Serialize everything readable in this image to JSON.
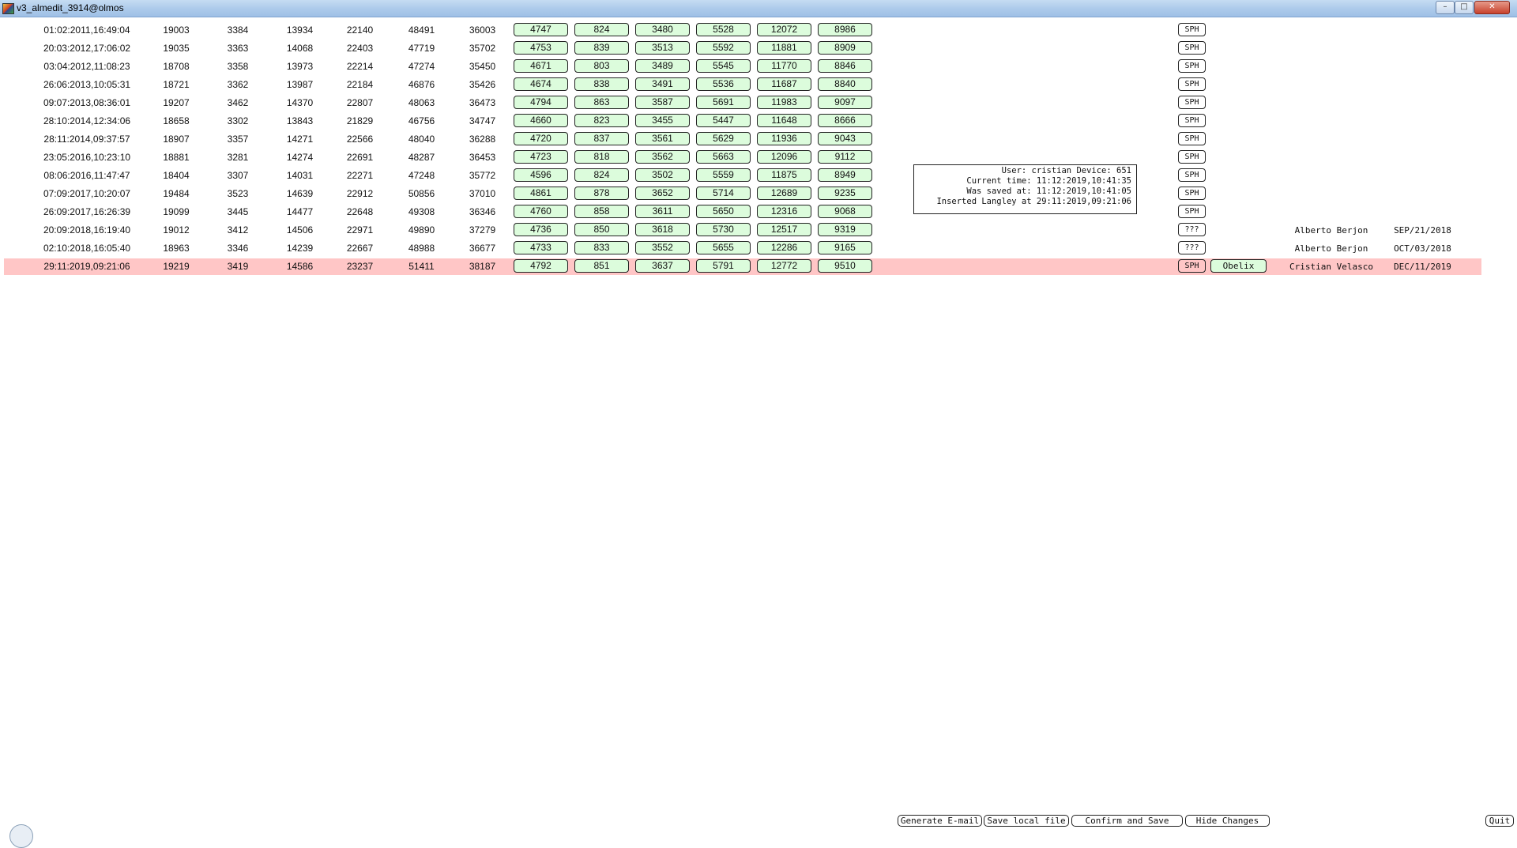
{
  "window": {
    "title": "v3_almedit_3914@olmos",
    "minimize_label": "–",
    "maximize_label": "□",
    "close_label": "✕"
  },
  "rows": [
    {
      "timestamp": "01:02:2011,16:49:04",
      "vals": [
        "19003",
        "3384",
        "13934",
        "22140",
        "48491",
        "36003"
      ],
      "editable": [
        "4747",
        "824",
        "3480",
        "5528",
        "12072",
        "8986"
      ],
      "tag": "SPH"
    },
    {
      "timestamp": "20:03:2012,17:06:02",
      "vals": [
        "19035",
        "3363",
        "14068",
        "22403",
        "47719",
        "35702"
      ],
      "editable": [
        "4753",
        "839",
        "3513",
        "5592",
        "11881",
        "8909"
      ],
      "tag": "SPH"
    },
    {
      "timestamp": "03:04:2012,11:08:23",
      "vals": [
        "18708",
        "3358",
        "13973",
        "22214",
        "47274",
        "35450"
      ],
      "editable": [
        "4671",
        "803",
        "3489",
        "5545",
        "11770",
        "8846"
      ],
      "tag": "SPH"
    },
    {
      "timestamp": "26:06:2013,10:05:31",
      "vals": [
        "18721",
        "3362",
        "13987",
        "22184",
        "46876",
        "35426"
      ],
      "editable": [
        "4674",
        "838",
        "3491",
        "5536",
        "11687",
        "8840"
      ],
      "tag": "SPH"
    },
    {
      "timestamp": "09:07:2013,08:36:01",
      "vals": [
        "19207",
        "3462",
        "14370",
        "22807",
        "48063",
        "36473"
      ],
      "editable": [
        "4794",
        "863",
        "3587",
        "5691",
        "11983",
        "9097"
      ],
      "tag": "SPH"
    },
    {
      "timestamp": "28:10:2014,12:34:06",
      "vals": [
        "18658",
        "3302",
        "13843",
        "21829",
        "46756",
        "34747"
      ],
      "editable": [
        "4660",
        "823",
        "3455",
        "5447",
        "11648",
        "8666"
      ],
      "tag": "SPH"
    },
    {
      "timestamp": "28:11:2014,09:37:57",
      "vals": [
        "18907",
        "3357",
        "14271",
        "22566",
        "48040",
        "36288"
      ],
      "editable": [
        "4720",
        "837",
        "3561",
        "5629",
        "11936",
        "9043"
      ],
      "tag": "SPH"
    },
    {
      "timestamp": "23:05:2016,10:23:10",
      "vals": [
        "18881",
        "3281",
        "14274",
        "22691",
        "48287",
        "36453"
      ],
      "editable": [
        "4723",
        "818",
        "3562",
        "5663",
        "12096",
        "9112"
      ],
      "tag": "SPH"
    },
    {
      "timestamp": "08:06:2016,11:47:47",
      "vals": [
        "18404",
        "3307",
        "14031",
        "22271",
        "47248",
        "35772"
      ],
      "editable": [
        "4596",
        "824",
        "3502",
        "5559",
        "11875",
        "8949"
      ],
      "tag": "SPH"
    },
    {
      "timestamp": "07:09:2017,10:20:07",
      "vals": [
        "19484",
        "3523",
        "14639",
        "22912",
        "50856",
        "37010"
      ],
      "editable": [
        "4861",
        "878",
        "3652",
        "5714",
        "12689",
        "9235"
      ],
      "tag": "SPH"
    },
    {
      "timestamp": "26:09:2017,16:26:39",
      "vals": [
        "19099",
        "3445",
        "14477",
        "22648",
        "49308",
        "36346"
      ],
      "editable": [
        "4760",
        "858",
        "3611",
        "5650",
        "12316",
        "9068"
      ],
      "tag": "SPH"
    },
    {
      "timestamp": "20:09:2018,16:19:40",
      "vals": [
        "19012",
        "3412",
        "14506",
        "22971",
        "49890",
        "37279"
      ],
      "editable": [
        "4736",
        "850",
        "3618",
        "5730",
        "12517",
        "9319"
      ],
      "tag": "???",
      "who": "Alberto Berjon",
      "when": "SEP/21/2018"
    },
    {
      "timestamp": "02:10:2018,16:05:40",
      "vals": [
        "18963",
        "3346",
        "14239",
        "22667",
        "48988",
        "36677"
      ],
      "editable": [
        "4733",
        "833",
        "3552",
        "5655",
        "12286",
        "9165"
      ],
      "tag": "???",
      "who": "Alberto Berjon",
      "when": "OCT/03/2018"
    },
    {
      "timestamp": "29:11:2019,09:21:06",
      "vals": [
        "19219",
        "3419",
        "14586",
        "23237",
        "51411",
        "38187"
      ],
      "editable": [
        "4792",
        "851",
        "3637",
        "5791",
        "12772",
        "9510"
      ],
      "tag": "SPH",
      "extra": "Obelix",
      "who": "Cristian Velasco",
      "when": "DEC/11/2019",
      "highlight": true
    }
  ],
  "tooltip": {
    "line1": "User: cristian Device: 651",
    "line2": "Current time: 11:12:2019,10:41:35",
    "line3": "Was saved at: 11:12:2019,10:41:05",
    "line4": "Inserted Langley at 29:11:2019,09:21:06"
  },
  "actions": {
    "generate_email": "Generate E-mail",
    "save_local": "Save local file",
    "confirm_save": "Confirm and Save",
    "hide_changes": "Hide Changes",
    "quit": "Quit"
  },
  "colors": {
    "editable_bg": "#dcfcdc",
    "highlight_row": "#ffc6c6",
    "titlebar": "#aecbeb"
  }
}
